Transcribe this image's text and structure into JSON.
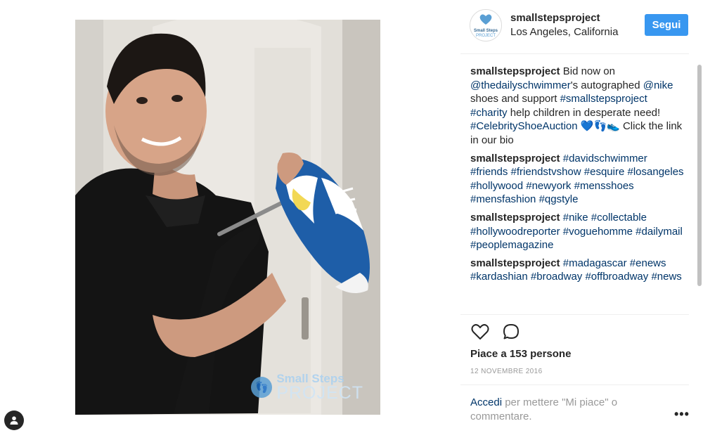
{
  "post": {
    "username": "smallstepsproject",
    "location": "Los Angeles, California",
    "follow_label": "Segui"
  },
  "avatar": {
    "line1": "Small Steps",
    "line2": "PROJECT"
  },
  "watermark": {
    "line1": "Small Steps",
    "line2": "PROJECT"
  },
  "caption": {
    "user": "smallstepsproject",
    "t1": " Bid now on ",
    "mention1": "@thedailyschwimmer",
    "t2": "'s autographed ",
    "mention2": "@nike",
    "t3": " shoes and support ",
    "tag1": "#smallstepsproject",
    "t4": " ",
    "tag2": "#charity",
    "t5": " help children in desperate need! ",
    "tag3": "#CelebrityShoeAuction",
    "emoji": " 💙👣👟 ",
    "t6": "Click the link in our bio"
  },
  "comments": [
    {
      "user": "smallstepsproject",
      "tags": [
        "#davidschwimmer",
        "#friends",
        "#friendstvshow",
        "#esquire",
        "#losangeles",
        "#hollywood",
        "#newyork",
        "#mensshoes",
        "#mensfashion",
        "#qgstyle"
      ]
    },
    {
      "user": "smallstepsproject",
      "tags": [
        "#nike",
        "#collectable",
        "#hollywoodreporter",
        "#voguehomme",
        "#dailymail",
        "#peoplemagazine"
      ]
    },
    {
      "user": "smallstepsproject",
      "tags": [
        "#madagascar",
        "#enews",
        "#kardashian",
        "#broadway",
        "#offbroadway",
        "#news"
      ]
    }
  ],
  "likes": {
    "prefix": "Piace a ",
    "count": "153",
    "suffix": " persone"
  },
  "date": "12 novembre 2016",
  "login": {
    "link": "Accedi",
    "text": " per mettere \"Mi piace\" o commentare."
  },
  "more": "•••",
  "icons": {
    "like": "heart-icon",
    "comment": "comment-icon",
    "tag": "user-tag-icon",
    "more": "more-options-icon"
  },
  "colors": {
    "follow": "#3897f0",
    "link": "#003569",
    "muted": "#999999",
    "text": "#262626"
  }
}
